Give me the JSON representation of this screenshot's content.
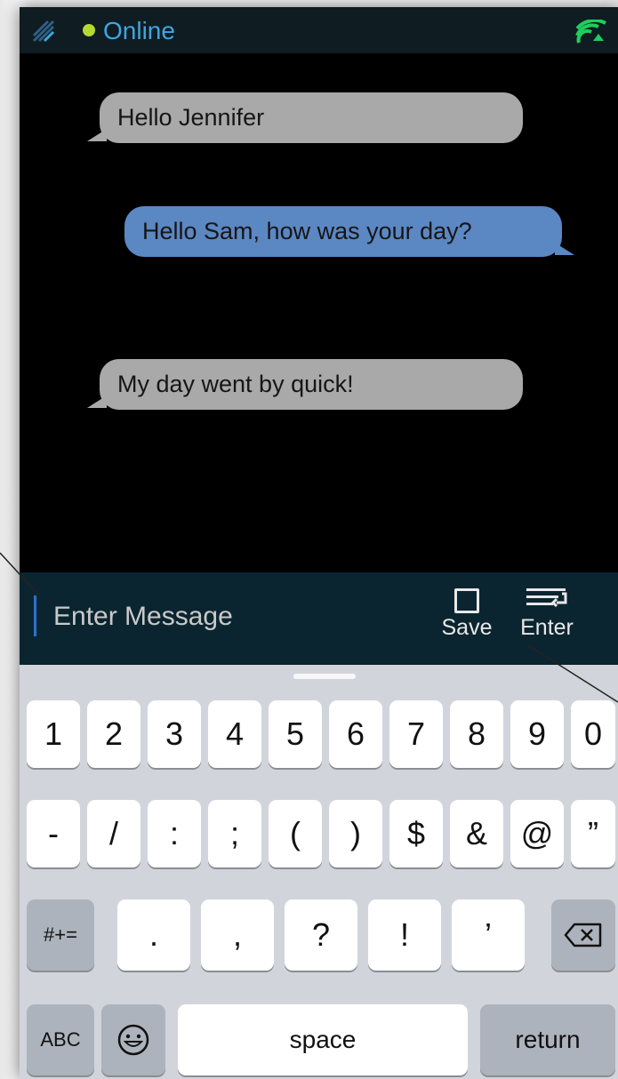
{
  "status_bar": {
    "status_text": "Online",
    "status_color": "#b6d931",
    "app_icon": "app-logo-icon",
    "signal_icon": "signal-strength-icon"
  },
  "chat": {
    "messages": [
      {
        "direction": "incoming",
        "text": "Hello Jennifer"
      },
      {
        "direction": "outgoing",
        "text": "Hello Sam, how was your day?"
      },
      {
        "direction": "incoming",
        "text": "My day went by quick!"
      }
    ],
    "incoming_color": "#a9a9a9",
    "outgoing_color": "#5b87c3"
  },
  "composer": {
    "placeholder": "Enter Message",
    "save_label": "Save",
    "enter_label": "Enter"
  },
  "keyboard": {
    "row1": [
      "1",
      "2",
      "3",
      "4",
      "5",
      "6",
      "7",
      "8",
      "9",
      "0"
    ],
    "row2": [
      "-",
      "/",
      ":",
      ";",
      "(",
      ")",
      "$",
      "&",
      "@",
      "”"
    ],
    "row3_left": "#+=",
    "row3": [
      ".",
      ",",
      "?",
      "!",
      "’"
    ],
    "row3_right_icon": "backspace-icon",
    "row4": {
      "abc": "ABC",
      "emoji_icon": "emoji-icon",
      "space": "space",
      "return": "return"
    }
  }
}
